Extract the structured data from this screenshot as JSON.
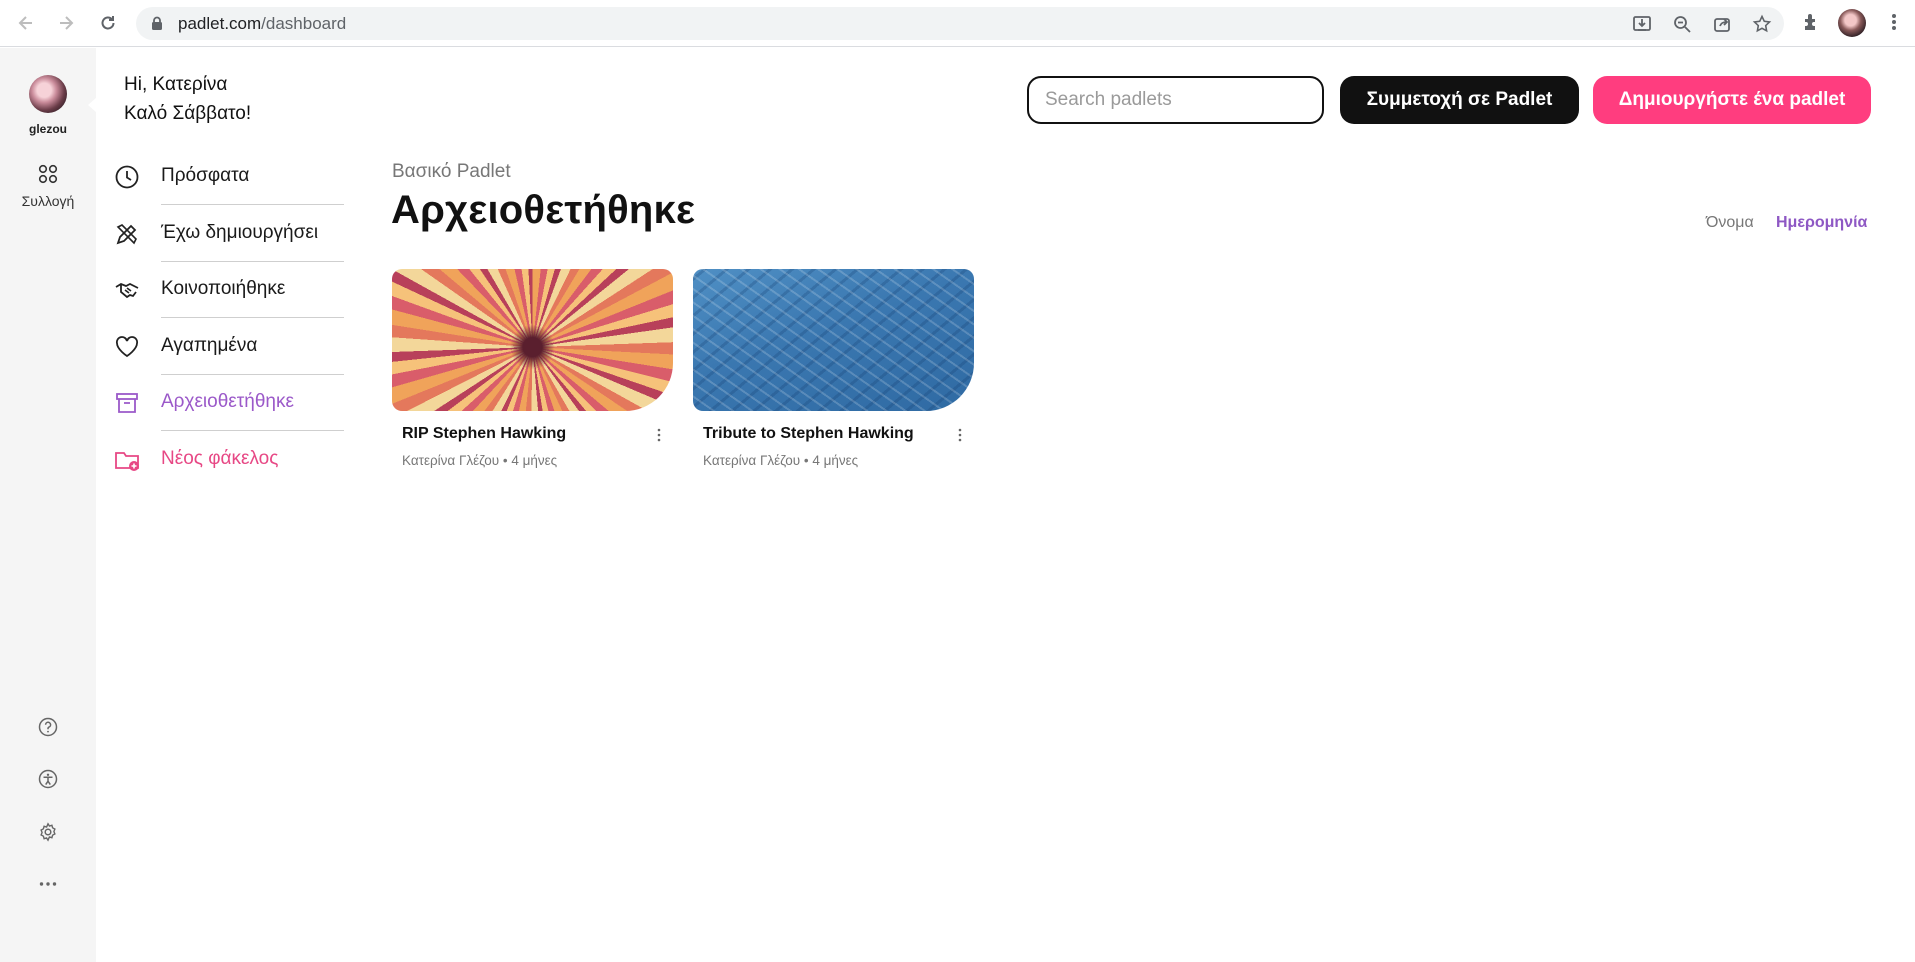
{
  "browser": {
    "url_host": "padlet.com",
    "url_path": "/dashboard"
  },
  "rail": {
    "username": "glezou",
    "collection_label": "Συλλογή"
  },
  "header": {
    "greeting": "Hi, Κατερίνα",
    "day_greeting": "Καλό Σάββατο!",
    "search_placeholder": "Search padlets",
    "join_button": "Συμμετοχή σε Padlet",
    "create_button": "Δημιουργήστε ένα padlet"
  },
  "nav": {
    "items": [
      {
        "label": "Πρόσφατα",
        "icon": "clock-icon"
      },
      {
        "label": "Έχω δημιουργήσει",
        "icon": "pencil-ruler-icon"
      },
      {
        "label": "Κοινοποιήθηκε",
        "icon": "handshake-icon"
      },
      {
        "label": "Αγαπημένα",
        "icon": "heart-icon"
      },
      {
        "label": "Αρχειοθετήθηκε",
        "icon": "archive-icon",
        "active": true
      },
      {
        "label": "Νέος φάκελος",
        "icon": "folder-add-icon"
      }
    ]
  },
  "main": {
    "breadcrumb": "Βασικό Padlet",
    "title": "Αρχειοθετήθηκε",
    "sort_name": "Όνομα",
    "sort_date": "Ημερομηνία",
    "cards": [
      {
        "title": "RIP Stephen Hawking",
        "meta": "Κατερίνα Γλέζου • 4 μήνες"
      },
      {
        "title": "Tribute to Stephen Hawking",
        "meta": "Κατερίνα Γλέζου • 4 μήνες"
      }
    ]
  },
  "colors": {
    "accent_purple": "#9b59c9",
    "accent_pink": "#ff3d7f",
    "join_button_bg": "#111111"
  }
}
